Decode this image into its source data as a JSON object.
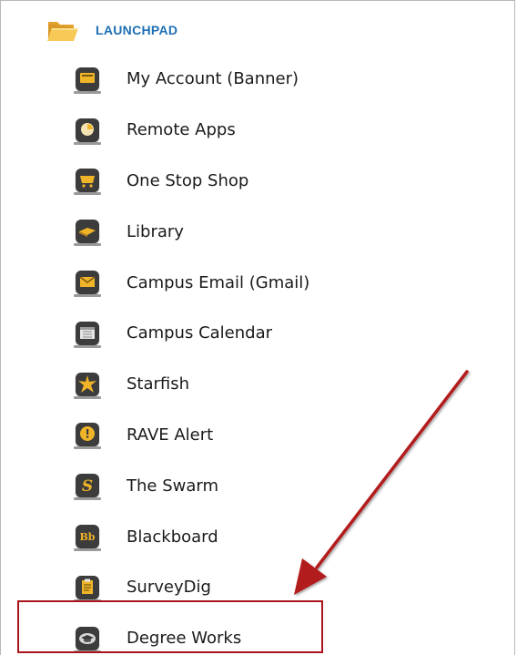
{
  "folder": {
    "label": "LAUNCHPAD",
    "label_color": "#1d6fb5",
    "icon": "folder-open-icon",
    "icon_color": "#f2b63a"
  },
  "items": [
    {
      "label": "My Account (Banner)",
      "icon": "my-account-icon"
    },
    {
      "label": "Remote Apps",
      "icon": "remote-apps-icon"
    },
    {
      "label": "One Stop Shop",
      "icon": "shopping-cart-icon"
    },
    {
      "label": "Library",
      "icon": "library-book-icon"
    },
    {
      "label": "Campus Email (Gmail)",
      "icon": "envelope-icon"
    },
    {
      "label": "Campus Calendar",
      "icon": "calendar-icon"
    },
    {
      "label": "Starfish",
      "icon": "starfish-icon"
    },
    {
      "label": "RAVE Alert",
      "icon": "alert-icon"
    },
    {
      "label": "The Swarm",
      "icon": "swarm-s-icon"
    },
    {
      "label": "Blackboard",
      "icon": "blackboard-bb-icon"
    },
    {
      "label": "SurveyDig",
      "icon": "survey-clipboard-icon"
    },
    {
      "label": "Degree Works",
      "icon": "graduation-cap-icon"
    }
  ],
  "highlight_target": "Degree Works",
  "annotation_color": "#b31b1f",
  "icon_accent": "#f0b429"
}
